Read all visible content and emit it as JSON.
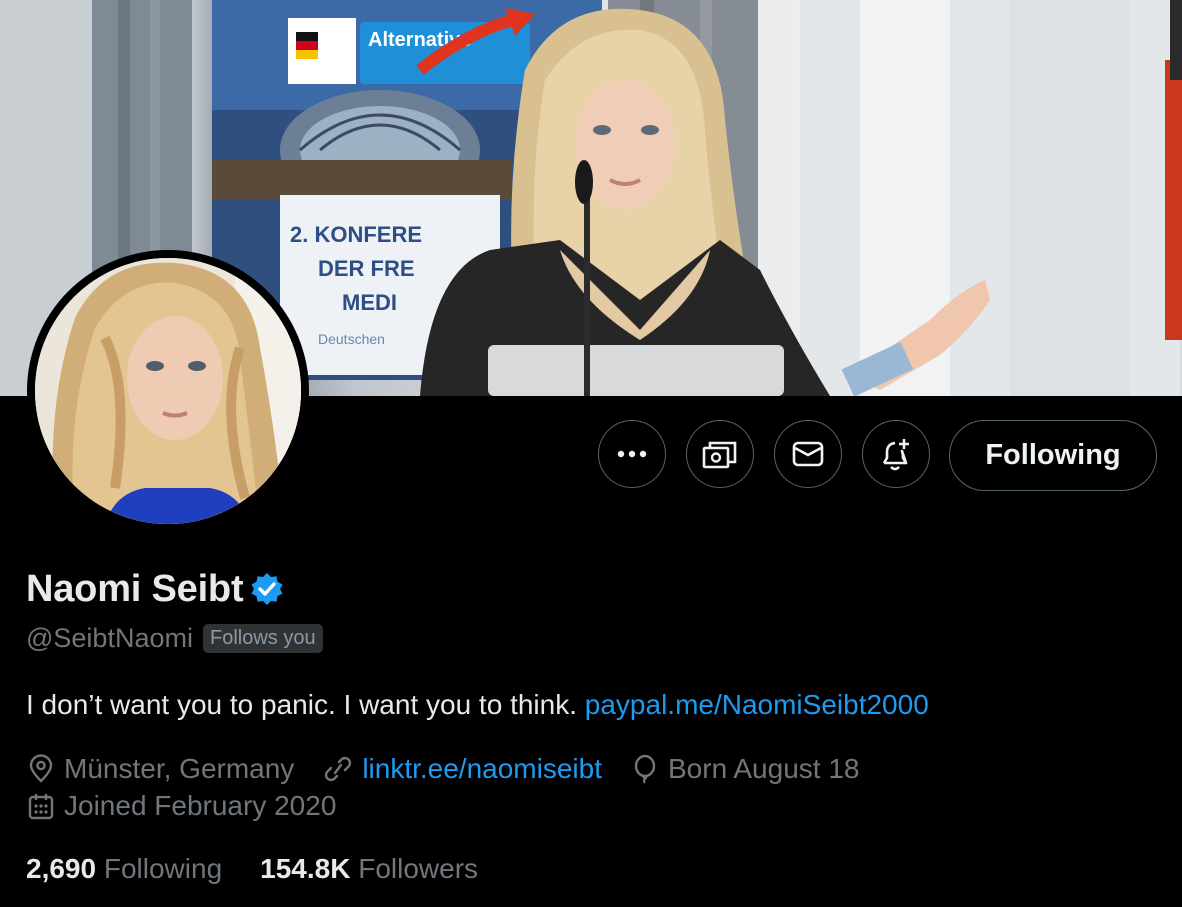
{
  "banner": {
    "sign_logo_text": "Alternative",
    "sign_line1": "2. KONFERE",
    "sign_line2": "DER FRE",
    "sign_line3": "MEDI",
    "sign_line4": "Deutschen"
  },
  "actions": {
    "more_icon": "more-horizontal-icon",
    "tip_icon": "tip-jar-icon",
    "message_icon": "envelope-icon",
    "notify_icon": "bell-plus-icon",
    "follow_label": "Following"
  },
  "profile": {
    "name": "Naomi Seibt",
    "handle": "@SeibtNaomi",
    "follows_you": "Follows you",
    "bio_text": "I don’t want you to panic. I want you to think.",
    "bio_link": "paypal.me/NaomiSeibt2000",
    "location": "Münster, Germany",
    "website": "linktr.ee/naomiseibt",
    "birthday": "Born August 18",
    "joined": "Joined February 2020"
  },
  "stats": {
    "following_count": "2,690",
    "following_label": "Following",
    "followers_count": "154.8K",
    "followers_label": "Followers"
  },
  "colors": {
    "accent": "#1d9bf0",
    "verified": "#1d9bf0",
    "muted_text": "#71767b",
    "border": "#536471"
  }
}
